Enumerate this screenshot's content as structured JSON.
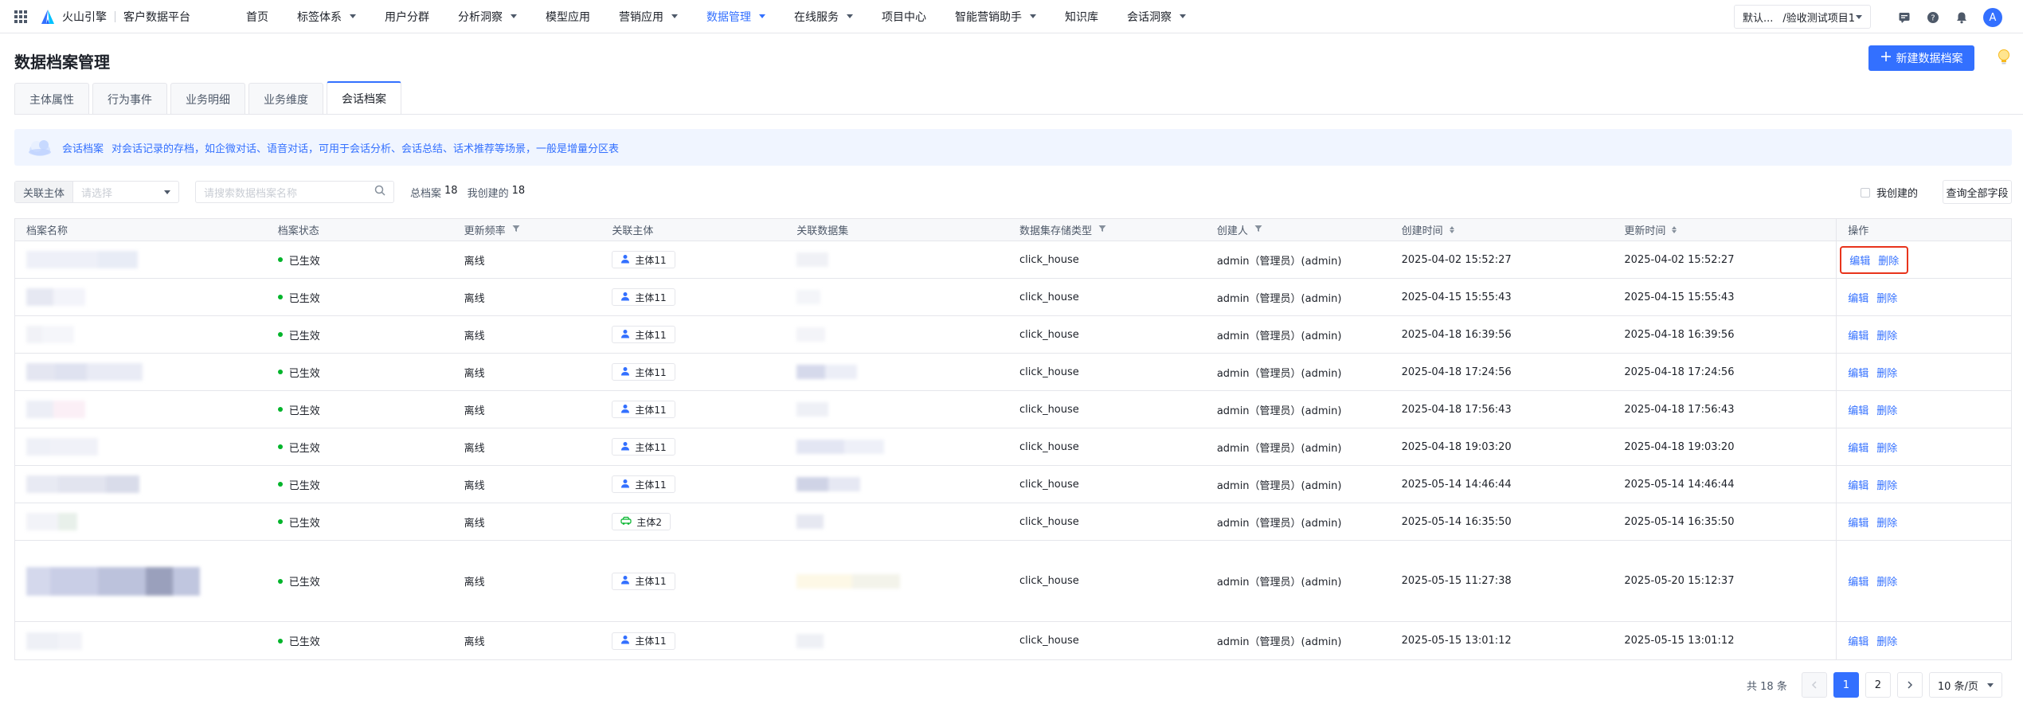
{
  "topbar": {
    "brand": "火山引擎",
    "product": "客户数据平台",
    "nav": [
      {
        "label": "首页",
        "has_menu": false,
        "active": false
      },
      {
        "label": "标签体系",
        "has_menu": true,
        "active": false
      },
      {
        "label": "用户分群",
        "has_menu": false,
        "active": false
      },
      {
        "label": "分析洞察",
        "has_menu": true,
        "active": false
      },
      {
        "label": "模型应用",
        "has_menu": false,
        "active": false
      },
      {
        "label": "营销应用",
        "has_menu": true,
        "active": false
      },
      {
        "label": "数据管理",
        "has_menu": true,
        "active": true
      },
      {
        "label": "在线服务",
        "has_menu": true,
        "active": false
      },
      {
        "label": "项目中心",
        "has_menu": false,
        "active": false
      },
      {
        "label": "智能营销助手",
        "has_menu": true,
        "active": false
      },
      {
        "label": "知识库",
        "has_menu": false,
        "active": false
      },
      {
        "label": "会话洞察",
        "has_menu": true,
        "active": false
      }
    ],
    "project_scope": "默认...",
    "project_name": "/验收测试项目1",
    "avatar_letter": "A",
    "icons": [
      "message-icon",
      "help-icon",
      "bell-icon"
    ]
  },
  "page": {
    "title": "数据档案管理",
    "new_button": "新建数据档案",
    "tabs": [
      "主体属性",
      "行为事件",
      "业务明细",
      "业务维度",
      "会话档案"
    ],
    "active_tab": 4
  },
  "banner": {
    "label": "会话档案",
    "text": "对会话记录的存档，如企微对话、语音对话，可用于会话分析、会话总结、话术推荐等场景，一般是增量分区表"
  },
  "filters": {
    "subject_label": "关联主体",
    "subject_placeholder": "请选择",
    "search_placeholder": "请搜索数据档案名称",
    "total_label": "总档案",
    "total_value": "18",
    "mine_label": "我创建的",
    "mine_value": "18",
    "my_created_checkbox": "我创建的",
    "query_all_fields": "查询全部字段"
  },
  "table": {
    "columns": [
      "档案名称",
      "档案状态",
      "更新频率",
      "关联主体",
      "关联数据集",
      "数据集存储类型",
      "创建人",
      "创建时间",
      "更新时间",
      "操作"
    ],
    "ops": {
      "edit": "编辑",
      "delete": "删除"
    },
    "rows": [
      {
        "status": "已生效",
        "freq": "离线",
        "subject": "主体11",
        "store": "click_house",
        "creator": "admin（管理员）(admin)",
        "ctime": "2025-04-02 15:52:27",
        "utime": "2025-04-02 15:52:27",
        "subject_type": "person"
      },
      {
        "status": "已生效",
        "freq": "离线",
        "subject": "主体11",
        "store": "click_house",
        "creator": "admin（管理员）(admin)",
        "ctime": "2025-04-15 15:55:43",
        "utime": "2025-04-15 15:55:43",
        "subject_type": "person"
      },
      {
        "status": "已生效",
        "freq": "离线",
        "subject": "主体11",
        "store": "click_house",
        "creator": "admin（管理员）(admin)",
        "ctime": "2025-04-18 16:39:56",
        "utime": "2025-04-18 16:39:56",
        "subject_type": "person"
      },
      {
        "status": "已生效",
        "freq": "离线",
        "subject": "主体11",
        "store": "click_house",
        "creator": "admin（管理员）(admin)",
        "ctime": "2025-04-18 17:24:56",
        "utime": "2025-04-18 17:24:56",
        "subject_type": "person"
      },
      {
        "status": "已生效",
        "freq": "离线",
        "subject": "主体11",
        "store": "click_house",
        "creator": "admin（管理员）(admin)",
        "ctime": "2025-04-18 17:56:43",
        "utime": "2025-04-18 17:56:43",
        "subject_type": "person"
      },
      {
        "status": "已生效",
        "freq": "离线",
        "subject": "主体11",
        "store": "click_house",
        "creator": "admin（管理员）(admin)",
        "ctime": "2025-04-18 19:03:20",
        "utime": "2025-04-18 19:03:20",
        "subject_type": "person"
      },
      {
        "status": "已生效",
        "freq": "离线",
        "subject": "主体11",
        "store": "click_house",
        "creator": "admin（管理员）(admin)",
        "ctime": "2025-05-14 14:46:44",
        "utime": "2025-05-14 14:46:44",
        "subject_type": "person"
      },
      {
        "status": "已生效",
        "freq": "离线",
        "subject": "主体2",
        "store": "click_house",
        "creator": "admin（管理员）(admin)",
        "ctime": "2025-05-14 16:35:50",
        "utime": "2025-05-14 16:35:50",
        "subject_type": "car"
      },
      {
        "status": "已生效",
        "freq": "离线",
        "subject": "主体11",
        "store": "click_house",
        "creator": "admin（管理员）(admin)",
        "ctime": "2025-05-15 11:27:38",
        "utime": "2025-05-20 15:12:37",
        "subject_type": "person"
      },
      {
        "status": "已生效",
        "freq": "离线",
        "subject": "主体11",
        "store": "click_house",
        "creator": "admin（管理员）(admin)",
        "ctime": "2025-05-15 13:01:12",
        "utime": "2025-05-15 13:01:12",
        "subject_type": "person"
      }
    ]
  },
  "pagination": {
    "total_prefix": "共",
    "total": "18",
    "total_suffix": "条",
    "pages": [
      "1",
      "2"
    ],
    "current": "1",
    "page_size": "10 条/页"
  },
  "colors": {
    "primary": "#3370ff",
    "success": "#00b42a",
    "highlight_border": "#e8341c"
  }
}
